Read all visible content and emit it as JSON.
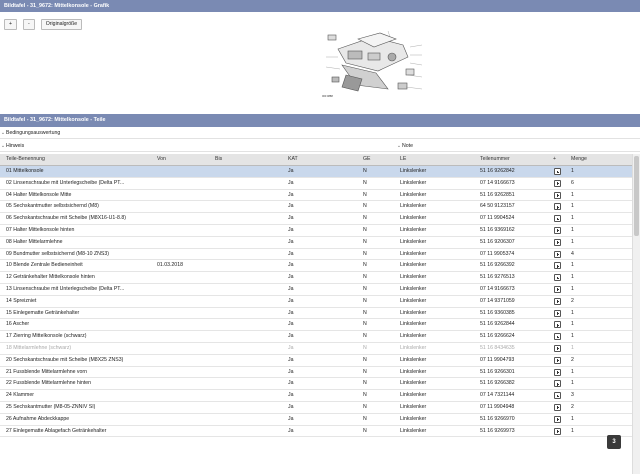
{
  "graphic_panel": {
    "title": "Bildtafel - 31_9672: Mittelkonsole - Grafik",
    "zoom_in_label": "+",
    "zoom_out_label": "-",
    "original_size_label": "Originalgröße",
    "diagram_caption": "000 0888"
  },
  "parts_panel": {
    "title": "Bildtafel - 31_9672: Mittelkonsole - Teile",
    "conditions_label": "Bedingungsauswertung",
    "hint_label": "Hinweis",
    "note_label": "Note"
  },
  "table": {
    "columns": [
      "Teile-Benennung",
      "Von",
      "Bis",
      "KAT",
      "GE",
      "LE",
      "Teilenummer",
      "+",
      "Menge"
    ],
    "rows": [
      {
        "name": "01 Mittelkonsole",
        "von": "",
        "bis": "",
        "kat": "Ja",
        "ge": "N",
        "le": "Linkslenker",
        "part": "51 16 9262842",
        "qty": "1",
        "selected": true
      },
      {
        "name": "02 Linsenschraube mit Unterlegscheibe (Delta PT...",
        "von": "",
        "bis": "",
        "kat": "Ja",
        "ge": "N",
        "le": "Linkslenker",
        "part": "07 14 9166673",
        "qty": "6"
      },
      {
        "name": "04 Halter Mittelkonsole Mitte",
        "von": "",
        "bis": "",
        "kat": "Ja",
        "ge": "N",
        "le": "Linkslenker",
        "part": "51 16 9262851",
        "qty": "1"
      },
      {
        "name": "05 Sechskantmutter selbstsichernd (M8)",
        "von": "",
        "bis": "",
        "kat": "Ja",
        "ge": "N",
        "le": "Linkslenker",
        "part": "64 50 9123157",
        "qty": "1"
      },
      {
        "name": "06 Sechskantschraube mit Scheibe (M8X16-U1-8.8)",
        "von": "",
        "bis": "",
        "kat": "Ja",
        "ge": "N",
        "le": "Linkslenker",
        "part": "07 11 9904524",
        "qty": "1"
      },
      {
        "name": "07 Halter Mittelkonsole hinten",
        "von": "",
        "bis": "",
        "kat": "Ja",
        "ge": "N",
        "le": "Linkslenker",
        "part": "51 16 9369162",
        "qty": "1"
      },
      {
        "name": "08 Halter Mittelarmlehne",
        "von": "",
        "bis": "",
        "kat": "Ja",
        "ge": "N",
        "le": "Linkslenker",
        "part": "51 16 9206307",
        "qty": "1"
      },
      {
        "name": "09 Bundmutter selbstsichernd (M8-10 ZNS3)",
        "von": "",
        "bis": "",
        "kat": "Ja",
        "ge": "N",
        "le": "Linkslenker",
        "part": "07 11 9905374",
        "qty": "4"
      },
      {
        "name": "10 Blende Zentrale Bedieneinheit",
        "von": "01.03.2018",
        "bis": "",
        "kat": "Ja",
        "ge": "N",
        "le": "Linkslenker",
        "part": "51 16 9266392",
        "qty": "1"
      },
      {
        "name": "12 Getränkehalter Mittelkonsole hinten",
        "von": "",
        "bis": "",
        "kat": "Ja",
        "ge": "N",
        "le": "Linkslenker",
        "part": "51 16 9276513",
        "qty": "1"
      },
      {
        "name": "13 Linsenschraube mit Unterlegscheibe (Delta PT...",
        "von": "",
        "bis": "",
        "kat": "Ja",
        "ge": "N",
        "le": "Linkslenker",
        "part": "07 14 9166673",
        "qty": "1"
      },
      {
        "name": "14 Spreizniet",
        "von": "",
        "bis": "",
        "kat": "Ja",
        "ge": "N",
        "le": "Linkslenker",
        "part": "07 14 9371059",
        "qty": "2"
      },
      {
        "name": "15 Einlegematte Getränkehalter",
        "von": "",
        "bis": "",
        "kat": "Ja",
        "ge": "N",
        "le": "Linkslenker",
        "part": "51 16 9360385",
        "qty": "1"
      },
      {
        "name": "16 Ascher",
        "von": "",
        "bis": "",
        "kat": "Ja",
        "ge": "N",
        "le": "Linkslenker",
        "part": "51 16 9262844",
        "qty": "1"
      },
      {
        "name": "17 Zierring Mittelkonsole (schwarz)",
        "von": "",
        "bis": "",
        "kat": "Ja",
        "ge": "N",
        "le": "Linkslenker",
        "part": "51 16 9266624",
        "qty": "1"
      },
      {
        "name": "18 Mittelarmlehne (schwarz)",
        "von": "",
        "bis": "",
        "kat": "Ja",
        "ge": "N",
        "le": "Linkslenker",
        "part": "51 16 8434635",
        "qty": "1",
        "dim": true
      },
      {
        "name": "20 Sechskantschraube mit Scheibe (M8X25 ZNS3)",
        "von": "",
        "bis": "",
        "kat": "Ja",
        "ge": "N",
        "le": "Linkslenker",
        "part": "07 11 9904793",
        "qty": "2"
      },
      {
        "name": "21 Fussblende Mittelarmlehne vorn",
        "von": "",
        "bis": "",
        "kat": "Ja",
        "ge": "N",
        "le": "Linkslenker",
        "part": "51 16 9266301",
        "qty": "1"
      },
      {
        "name": "22 Fussblende Mittelarmlehne hinten",
        "von": "",
        "bis": "",
        "kat": "Ja",
        "ge": "N",
        "le": "Linkslenker",
        "part": "51 16 9266382",
        "qty": "1"
      },
      {
        "name": "24 Klammer",
        "von": "",
        "bis": "",
        "kat": "Ja",
        "ge": "N",
        "le": "Linkslenker",
        "part": "07 14 7321144",
        "qty": "3"
      },
      {
        "name": "25 Sechskantmutter (M8-05-ZNNIV SI)",
        "von": "",
        "bis": "",
        "kat": "Ja",
        "ge": "N",
        "le": "Linkslenker",
        "part": "07 11 9904948",
        "qty": "2"
      },
      {
        "name": "26 Aufnahme Abdeckkappe",
        "von": "",
        "bis": "",
        "kat": "Ja",
        "ge": "N",
        "le": "Linkslenker",
        "part": "51 16 9266970",
        "qty": "1"
      },
      {
        "name": "27 Einlegematte Ablagefach Getränkehalter",
        "von": "",
        "bis": "",
        "kat": "Ja",
        "ge": "N",
        "le": "Linkslenker",
        "part": "51 16 9269973",
        "qty": "1"
      }
    ]
  },
  "page_badge": "3"
}
